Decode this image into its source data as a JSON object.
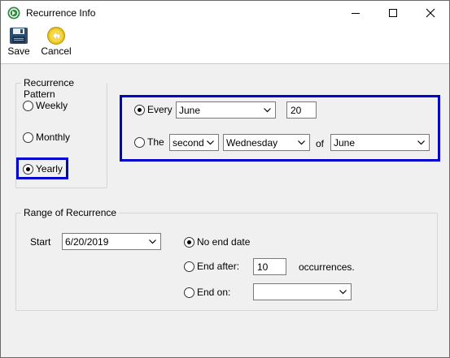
{
  "window": {
    "title": "Recurrence Info"
  },
  "toolbar": {
    "save_label": "Save",
    "cancel_label": "Cancel"
  },
  "pattern": {
    "legend": "Recurrence Pattern",
    "options": [
      {
        "label": "Weekly",
        "selected": false
      },
      {
        "label": "Monthly",
        "selected": false
      },
      {
        "label": "Yearly",
        "selected": true
      }
    ]
  },
  "yearly": {
    "every_label": "Every",
    "every_selected": true,
    "every_month": "June",
    "every_day": "20",
    "the_label": "The",
    "the_selected": false,
    "the_ordinal": "second",
    "the_weekday": "Wednesday",
    "of_label": "of",
    "the_month": "June"
  },
  "range": {
    "legend": "Range of Recurrence",
    "start_label": "Start",
    "start_date": "6/20/2019",
    "no_end_label": "No end date",
    "no_end_selected": true,
    "end_after_label": "End after:",
    "end_after_selected": false,
    "end_after_count": "10",
    "occurrences_label": "occurrences.",
    "end_on_label": "End on:",
    "end_on_selected": false,
    "end_on_date": ""
  },
  "colors": {
    "highlight": "#0000cc",
    "panel": "#f0f0f0"
  }
}
